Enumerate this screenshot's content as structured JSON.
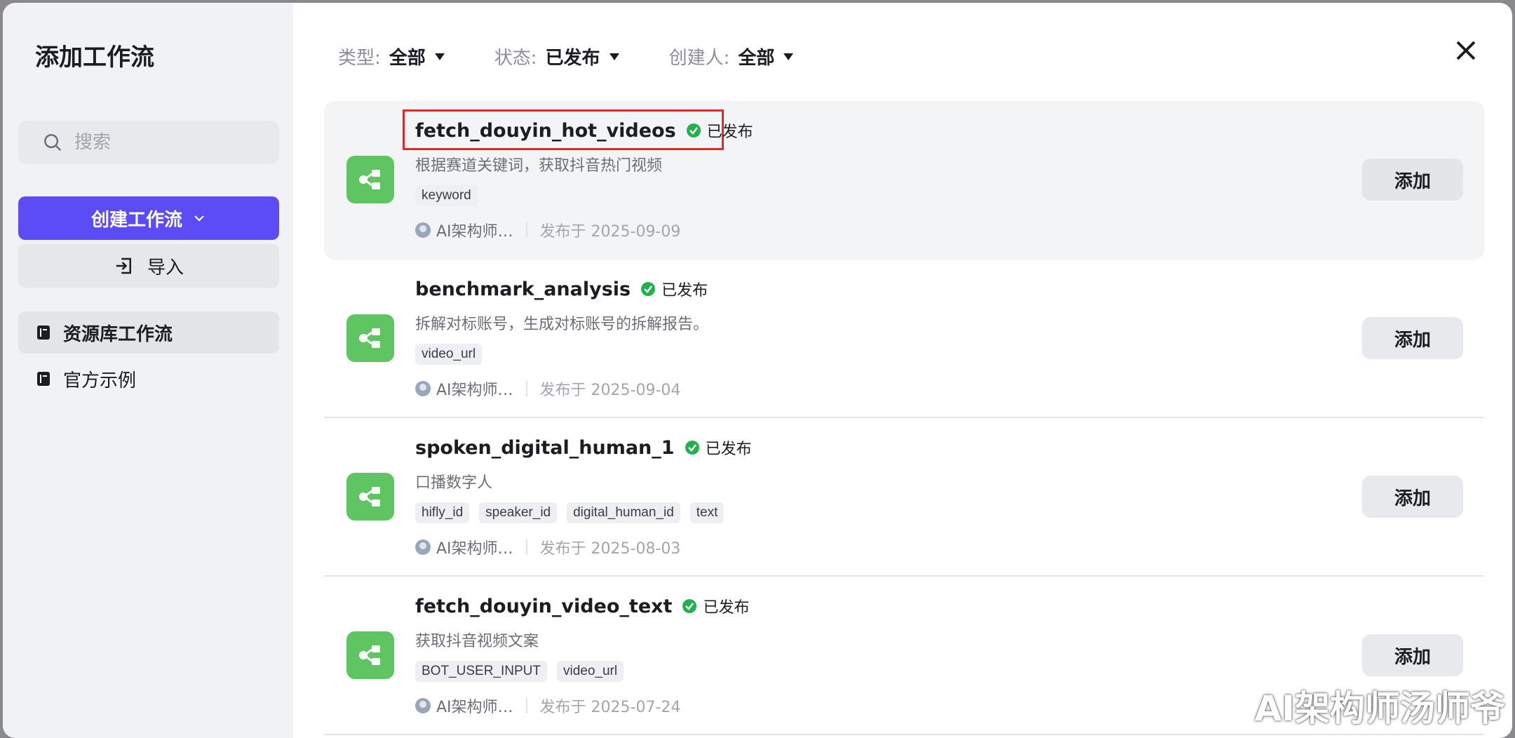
{
  "sidebar": {
    "title": "添加工作流",
    "search_placeholder": "搜索",
    "create_label": "创建工作流",
    "import_label": "导入",
    "nav": [
      {
        "label": "资源库工作流",
        "active": true
      },
      {
        "label": "官方示例",
        "active": false
      }
    ]
  },
  "filters": [
    {
      "label": "类型:",
      "value": "全部"
    },
    {
      "label": "状态:",
      "value": "已发布"
    },
    {
      "label": "创建人:",
      "value": "全部"
    }
  ],
  "workflows": [
    {
      "title": "fetch_douyin_hot_videos",
      "status": "已发布",
      "description": "根据赛道关键词，获取抖音热门视频",
      "tags": [
        "keyword"
      ],
      "author": "AI架构师…",
      "published": "发布于 2025-09-09",
      "add_label": "添加"
    },
    {
      "title": "benchmark_analysis",
      "status": "已发布",
      "description": "拆解对标账号，生成对标账号的拆解报告。",
      "tags": [
        "video_url"
      ],
      "author": "AI架构师…",
      "published": "发布于 2025-09-04",
      "add_label": "添加"
    },
    {
      "title": "spoken_digital_human_1",
      "status": "已发布",
      "description": "口播数字人",
      "tags": [
        "hifly_id",
        "speaker_id",
        "digital_human_id",
        "text"
      ],
      "author": "AI架构师…",
      "published": "发布于 2025-08-03",
      "add_label": "添加"
    },
    {
      "title": "fetch_douyin_video_text",
      "status": "已发布",
      "description": "获取抖音视频文案",
      "tags": [
        "BOT_USER_INPUT",
        "video_url"
      ],
      "author": "AI架构师…",
      "published": "发布于 2025-07-24",
      "add_label": "添加"
    }
  ],
  "watermark": "AI架构师汤师爷",
  "colors": {
    "accent": "#5b4cf6",
    "workflow_icon": "#5fc562",
    "status_ok": "#22b14c",
    "highlight": "#e02a2a"
  }
}
